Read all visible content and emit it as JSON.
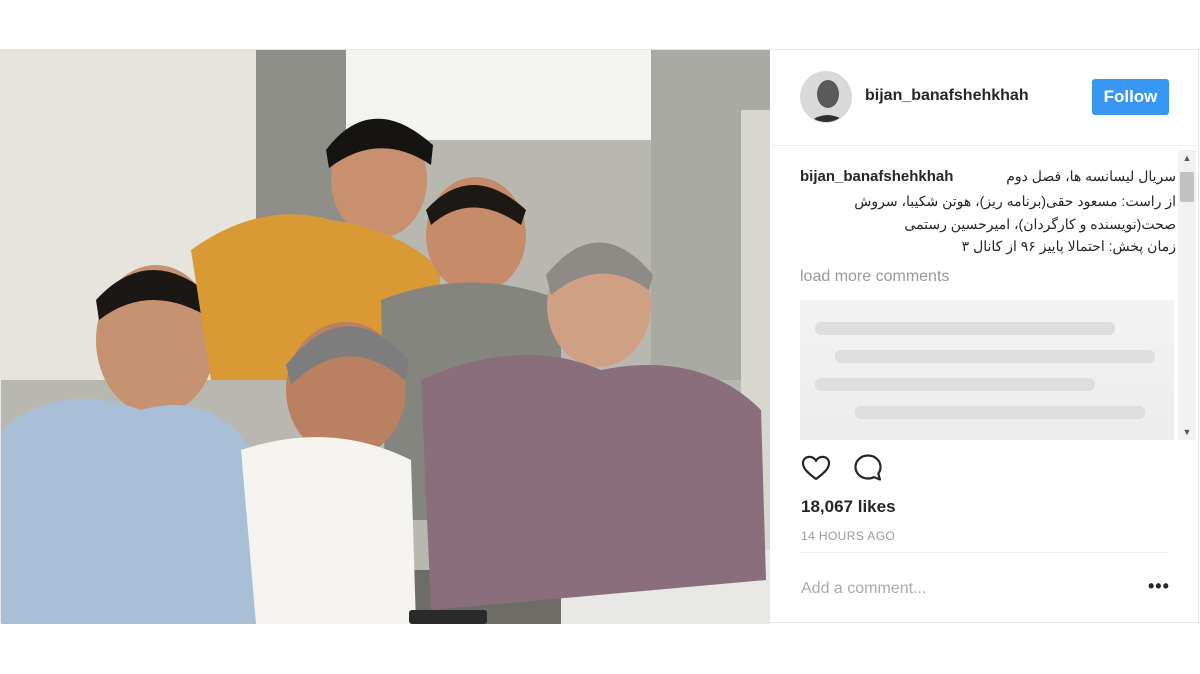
{
  "post": {
    "username": "bijan_banafshehkhah",
    "follow_label": "Follow",
    "caption_user": "bijan_banafshehkhah",
    "caption_lines": [
      "سریال لیسانسه ها، فصل دوم",
      "از راست: مسعود حقی(برنامه ریز)، هوتن شکیبا، سروش",
      "صحت(نویسنده و کارگردان)، امیرحسین رستمی",
      "زمان پخش: احتمالا پاییز ۹۶ از کانال ۳"
    ],
    "load_more": "load more comments",
    "likes": "18,067 likes",
    "time": "14 HOURS AGO",
    "add_comment_placeholder": "Add a comment...",
    "more_label": "•••"
  },
  "icons": {
    "like": "heart-icon",
    "comment": "comment-icon",
    "more": "more-options-icon"
  },
  "colors": {
    "follow_button": "#3897f0",
    "muted_text": "#999999",
    "divider": "#efefef"
  }
}
